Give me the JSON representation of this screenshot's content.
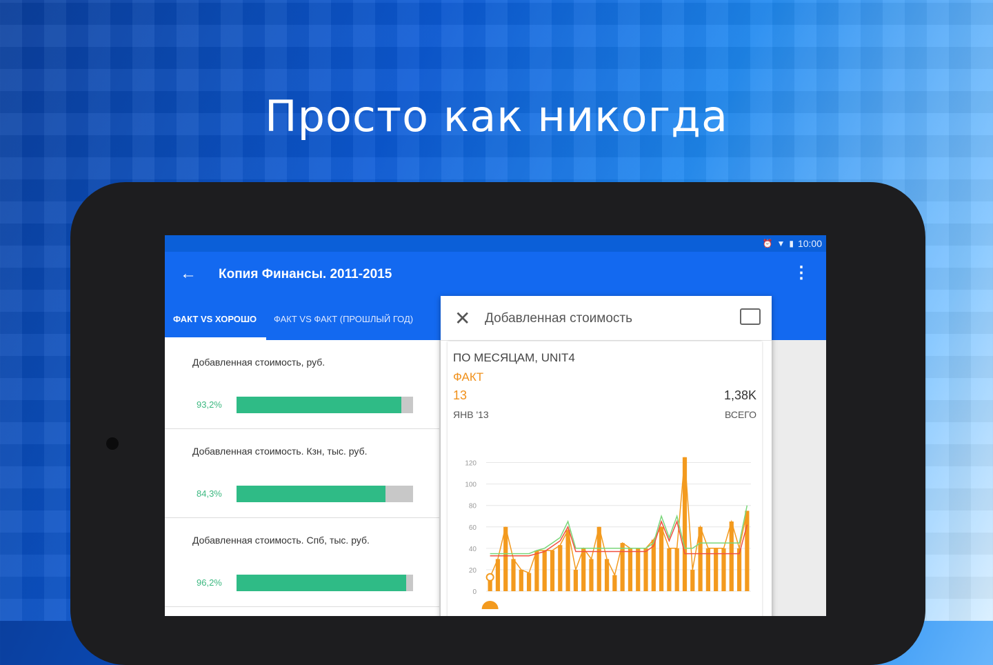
{
  "headline": "Просто как никогда",
  "status": {
    "time": "10:00"
  },
  "appbar": {
    "title": "Копия Финансы. 2011-2015"
  },
  "tabs": [
    {
      "label": "Факт vs хорошо"
    },
    {
      "label": "Факт vs факт (прошлый год)"
    }
  ],
  "kpis": [
    {
      "label": "Добавленная стоимость, руб.",
      "percent": "93,2%",
      "fill": 0.932
    },
    {
      "label": "Добавленная стоимость. Кзн, тыс. руб.",
      "percent": "84,3%",
      "fill": 0.843
    },
    {
      "label": "Добавленная стоимость. Спб, тыс. руб.",
      "percent": "96,2%",
      "fill": 0.962
    }
  ],
  "panel": {
    "title": "Добавленная стоимость",
    "subtitle": "ПО МЕСЯЦАМ, UNIT4",
    "metric": "ФАКТ",
    "value": "13",
    "date": "ЯНВ '13",
    "total": "1,38K",
    "total_label": "ВСЕГО"
  },
  "colors": {
    "fact": "#f39a1e",
    "plan_green": "#7ad67a",
    "plan_red": "#f05040",
    "bar_green": "#2fbb86"
  },
  "chart_data": {
    "type": "bar",
    "ylim": [
      0,
      130
    ],
    "yticks": [
      0,
      20,
      40,
      60,
      80,
      100,
      120
    ],
    "series": [
      {
        "values": [
          13,
          30,
          60,
          30,
          20,
          17,
          38,
          38,
          38,
          43,
          57,
          20,
          40,
          30,
          60,
          30,
          15,
          45,
          40,
          40,
          40,
          48,
          60,
          40,
          40,
          125,
          20,
          60,
          40,
          40,
          40,
          65,
          40,
          75
        ]
      }
    ],
    "line_green": [
      35,
      35,
      35,
      35,
      35,
      35,
      38,
      40,
      45,
      50,
      65,
      40,
      40,
      40,
      40,
      40,
      40,
      40,
      40,
      40,
      40,
      45,
      70,
      50,
      70,
      40,
      40,
      45,
      45,
      45,
      45,
      45,
      45,
      80
    ],
    "line_red": [
      33,
      33,
      33,
      33,
      33,
      33,
      35,
      37,
      42,
      47,
      60,
      37,
      37,
      37,
      37,
      37,
      37,
      37,
      37,
      37,
      37,
      42,
      65,
      47,
      65,
      35,
      35,
      35,
      35,
      35,
      35,
      35,
      35,
      62
    ]
  }
}
